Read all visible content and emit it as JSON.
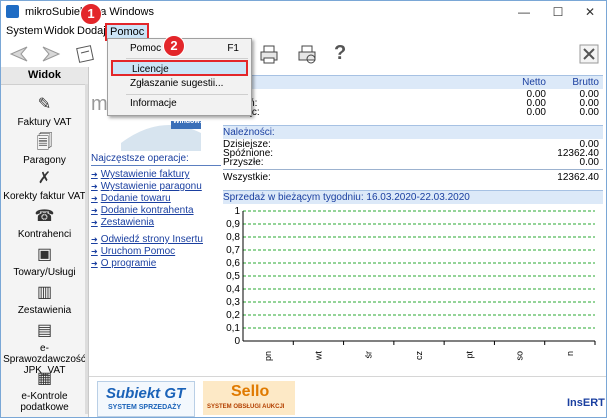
{
  "window": {
    "title": "mikroSubiekt dla Windows"
  },
  "menu": {
    "items": [
      "System",
      "Widok",
      "Dodaj",
      "Pomoc"
    ]
  },
  "dropdown": {
    "items": [
      {
        "label": "Pomoc",
        "shortcut": "F1"
      },
      {
        "label": "Licencje",
        "shortcut": ""
      },
      {
        "label": "Zgłaszanie sugestii...",
        "shortcut": ""
      },
      {
        "label": "Informacje",
        "shortcut": ""
      }
    ]
  },
  "badges": [
    "1",
    "2"
  ],
  "sidebar": {
    "header": "Widok",
    "items": [
      {
        "label": "Faktury VAT",
        "icon": "invoice-icon"
      },
      {
        "label": "Paragony",
        "icon": "receipt-icon"
      },
      {
        "label": "Korekty faktur VAT",
        "icon": "correction-icon"
      },
      {
        "label": "Kontrahenci",
        "icon": "contacts-icon"
      },
      {
        "label": "Towary/Usługi",
        "icon": "goods-icon"
      },
      {
        "label": "Zestawienia",
        "icon": "reports-icon"
      },
      {
        "label": "e-Sprawozdawczość JPK_VAT",
        "icon": "jpk-icon"
      },
      {
        "label": "e-Kontrole podatkowe",
        "icon": "tax-audit-icon"
      }
    ]
  },
  "logo": {
    "caption": "dla Windows"
  },
  "quick": {
    "title": "Najczęstsze operacje:",
    "links": [
      "Wystawienie faktury",
      "Wystawienie paragonu",
      "Dodanie towaru",
      "Dodanie kontrahenta",
      "Zestawienia"
    ],
    "links2": [
      "Odwiedź strony Insertu",
      "Uruchom Pomoc",
      "O programie"
    ]
  },
  "sales": {
    "col_netto": "Netto",
    "col_brutto": "Brutto",
    "rows": [
      {
        "label": "",
        "netto": "0.00",
        "brutto": "0.00"
      },
      {
        "label": "tydzień:",
        "netto": "0.00",
        "brutto": "0.00"
      },
      {
        "label": "miesiąc:",
        "netto": "0.00",
        "brutto": "0.00"
      }
    ]
  },
  "receivables": {
    "title": "Należności:",
    "rows": [
      {
        "label": "Dzisiejsze:",
        "value": "0.00"
      },
      {
        "label": "Spóźnione:",
        "value": "12362.40"
      },
      {
        "label": "Przyszłe:",
        "value": "0.00"
      }
    ],
    "total_label": "Wszystkie:",
    "total_value": "12362.40"
  },
  "chart_data": {
    "type": "bar",
    "title": "Sprzedaż w bieżącym tygodniu: 16.03.2020-22.03.2020",
    "categories": [
      "pn",
      "wt",
      "śr",
      "cz",
      "pt",
      "so",
      "n"
    ],
    "values": [
      0,
      0,
      0,
      0,
      0,
      0,
      0
    ],
    "y_ticks": [
      "1",
      "0,9",
      "0,8",
      "0,7",
      "0,6",
      "0,5",
      "0,4",
      "0,3",
      "0,2",
      "0,1",
      "0"
    ],
    "ylim": [
      0,
      1
    ],
    "grid": true,
    "grid_color": "#2aa830"
  },
  "bottom": {
    "subiekt_brand": "Subiekt GT",
    "subiekt_sub": "SYSTEM SPRZEDAŻY",
    "sello_brand": "Sello",
    "sello_sub": "SYSTEM OBSŁUGI AUKCJI",
    "insert": "InsERT"
  }
}
